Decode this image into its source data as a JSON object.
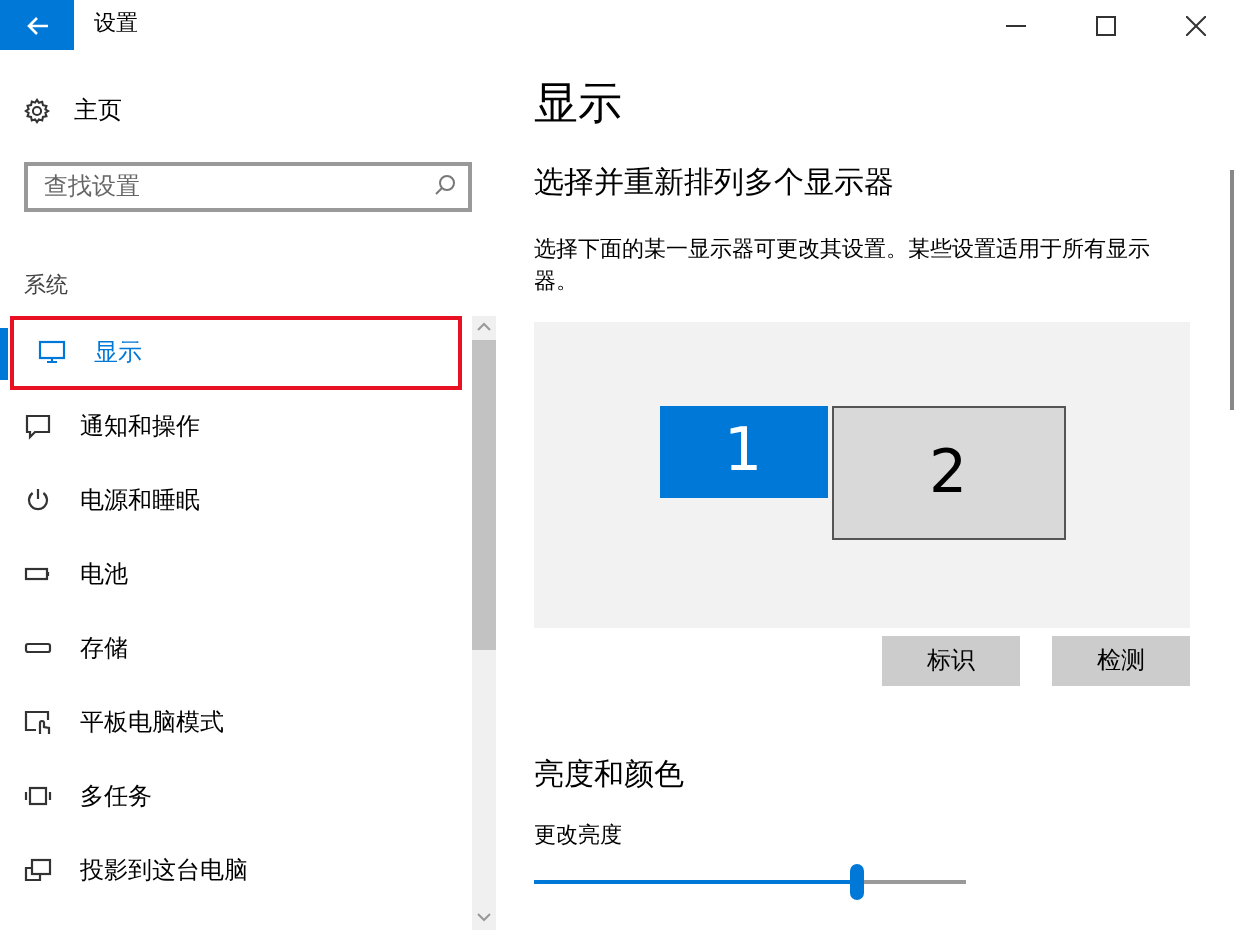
{
  "window": {
    "title": "设置"
  },
  "sidebar": {
    "home": "主页",
    "search": {
      "placeholder": "查找设置"
    },
    "section": "系统",
    "items": [
      {
        "label": "显示",
        "kind": "monitor",
        "selected": true
      },
      {
        "label": "通知和操作",
        "kind": "message",
        "selected": false
      },
      {
        "label": "电源和睡眠",
        "kind": "power",
        "selected": false
      },
      {
        "label": "电池",
        "kind": "battery",
        "selected": false
      },
      {
        "label": "存储",
        "kind": "storage",
        "selected": false
      },
      {
        "label": "平板电脑模式",
        "kind": "tablet",
        "selected": false
      },
      {
        "label": "多任务",
        "kind": "multitask",
        "selected": false
      },
      {
        "label": "投影到这台电脑",
        "kind": "project",
        "selected": false
      }
    ]
  },
  "main": {
    "title": "显示",
    "subtitle": "选择并重新排列多个显示器",
    "description": "选择下面的某一显示器可更改其设置。某些设置适用于所有显示器。",
    "monitors": [
      {
        "label": "1",
        "selected": true
      },
      {
        "label": "2",
        "selected": false
      }
    ],
    "buttons": [
      "标识",
      "检测"
    ],
    "brightness": {
      "heading": "亮度和颜色",
      "label": "更改亮度",
      "level": 0.745
    }
  }
}
